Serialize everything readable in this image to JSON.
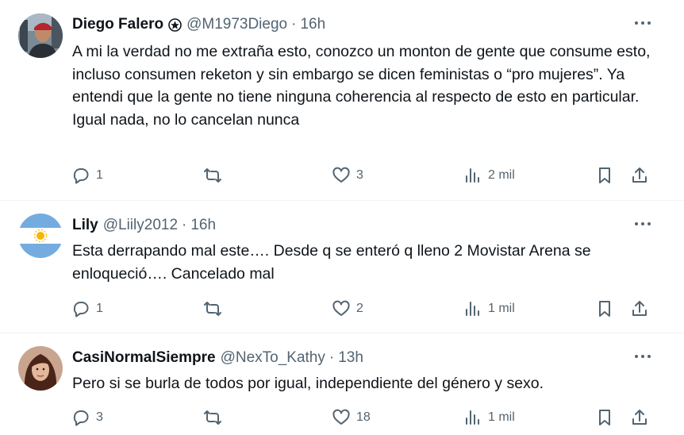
{
  "tweets": [
    {
      "display_name": "Diego Falero",
      "handle": "@M1973Diego",
      "separator": "·",
      "time": "16h",
      "text": "A mi la verdad no me extraña esto, conozco un monton de gente que consume esto, incluso consumen reketon y sin embargo se dicen feministas o “pro mujeres”. Ya entendi que la gente no tiene ninguna coherencia al respecto de esto en particular. Igual nada, no lo cancelan nunca",
      "replies": "1",
      "retweets": "",
      "likes": "3",
      "views": "2 mil"
    },
    {
      "display_name": "Lily",
      "handle": "@Liily2012",
      "separator": "·",
      "time": "16h",
      "text": "Esta derrapando mal este…. Desde q se enteró q lleno 2 Movistar Arena se enloqueció…. Cancelado mal",
      "replies": "1",
      "retweets": "",
      "likes": "2",
      "views": "1 mil"
    },
    {
      "display_name": "CasiNormalSiempre",
      "handle": "@NexTo_Kathy",
      "separator": "·",
      "time": "13h",
      "text": "Pero si se burla de todos por igual, independiente del género y sexo.",
      "replies": "3",
      "retweets": "",
      "likes": "18",
      "views": "1 mil"
    }
  ],
  "colors": {
    "text_primary": "#0f1419",
    "text_secondary": "#536471",
    "divider": "#eff3f4",
    "argentina_blue": "#74acdf"
  },
  "icons": [
    "reply-icon",
    "retweet-icon",
    "like-icon",
    "views-icon",
    "bookmark-icon",
    "share-icon",
    "more-icon",
    "verified-style-badge-icon"
  ]
}
